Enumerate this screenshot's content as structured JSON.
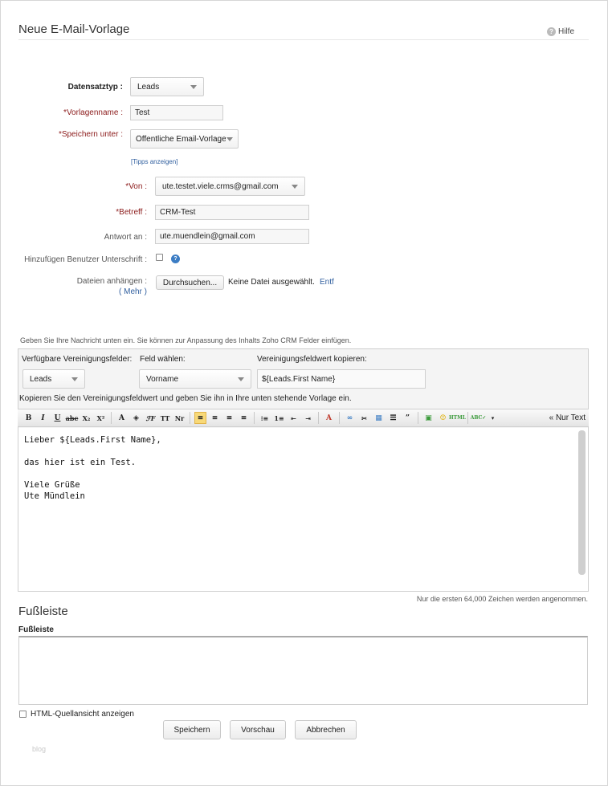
{
  "header": {
    "title": "Neue E-Mail-Vorlage",
    "help_label": "Hilfe"
  },
  "form": {
    "record_type_label": "Datensatztyp :",
    "record_type_value": "Leads",
    "template_name_label": "*Vorlagenname :",
    "template_name_value": "Test",
    "save_under_label": "*Speichern unter :",
    "save_under_value": "Öffentliche Email-Vorlage",
    "tips_link": "[Tipps anzeigen]",
    "from_label": "*Von :",
    "from_value": "ute.testet.viele.crms@gmail.com",
    "subject_label": "*Betreff :",
    "subject_value": "CRM-Test",
    "reply_to_label": "Antwort an :",
    "reply_to_value": "ute.muendlein@gmail.com",
    "add_signature_label": "Hinzufügen Benutzer Unterschrift :",
    "attach_label": "Dateien anhängen :",
    "more_link": "( Mehr )",
    "browse_button": "Durchsuchen...",
    "no_file_text": "Keine Datei ausgewählt.",
    "remove_link": "Entf"
  },
  "merge": {
    "intro": "Geben Sie Ihre Nachricht unten ein. Sie können zur Anpassung des Inhalts Zoho CRM Felder einfügen.",
    "available_label": "Verfügbare Vereinigungsfelder:",
    "available_value": "Leads",
    "choose_label": "Feld wählen:",
    "choose_value": "Vorname",
    "copy_label": "Vereinigungsfeldwert kopieren:",
    "copy_value": "${Leads.First Name}",
    "instruction": "Kopieren Sie den Vereinigungsfeldwert und geben Sie ihn in Ihre unten stehende Vorlage ein."
  },
  "toolbar": {
    "plain_text": "« Nur Text"
  },
  "editor": {
    "body": "Lieber ${Leads.First Name},\n\ndas hier ist ein Test.\n\nViele Grüße\nUte Mündlein"
  },
  "char_limit": "Nur die ersten 64,000 Zeichen werden angenommen.",
  "footer": {
    "section_title": "Fußleiste",
    "field_label": "Fußleiste"
  },
  "html_source_label": "HTML-Quellansicht anzeigen",
  "buttons": {
    "save": "Speichern",
    "preview": "Vorschau",
    "cancel": "Abbrechen"
  },
  "watermark": "blog",
  "colors": {
    "required": "#8b1a1a",
    "link": "#3361a0",
    "highlight": "#f8d978"
  }
}
